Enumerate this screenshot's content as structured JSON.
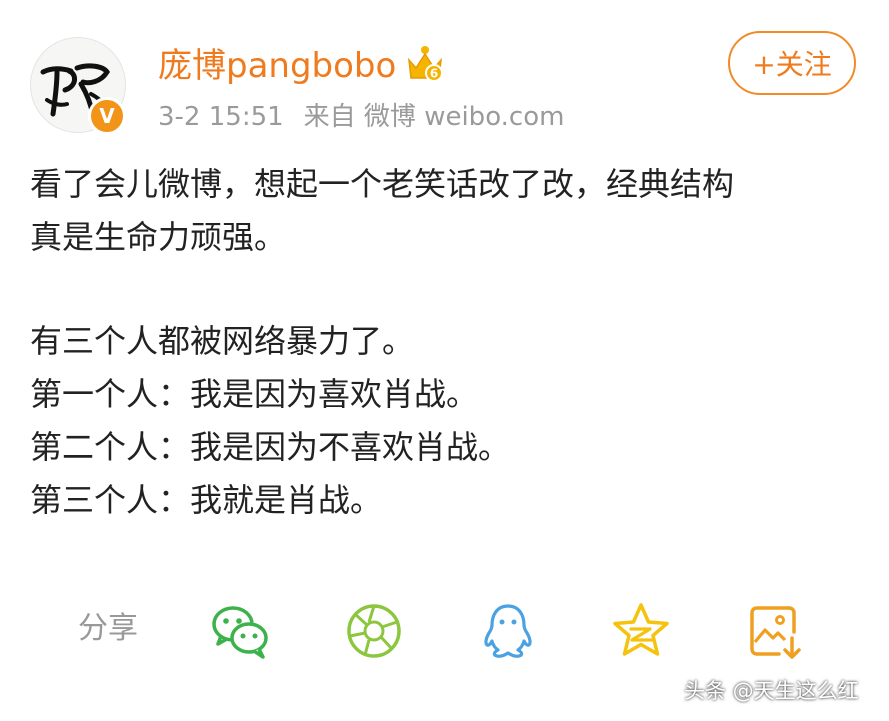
{
  "header": {
    "username": "庞博pangbobo",
    "verified_badge": "V",
    "level_badge": "6",
    "time": "3-2 15:51",
    "source": "来自 微博 weibo.com",
    "follow_label": "+关注"
  },
  "post": {
    "paragraphs": [
      "看了会儿微博，想起一个老笑话改了改，经典结构",
      "真是生命力顽强。",
      "",
      "有三个人都被网络暴力了。",
      "第一个人：我是因为喜欢肖战。",
      "第二个人：我是因为不喜欢肖战。",
      "第三个人：我就是肖战。"
    ]
  },
  "share": {
    "label": "分享",
    "icons": [
      "wechat-icon",
      "moments-icon",
      "qq-icon",
      "qzone-icon",
      "save-image-icon"
    ]
  },
  "watermark": "头条 @天生这么红",
  "colors": {
    "accent": "#f07b1e",
    "wechat": "#3cb34a",
    "moments": "#8cc63f",
    "qq": "#4aa3e0",
    "qzone": "#f5c20e",
    "save": "#f0a020",
    "meta_gray": "#9a9a9a"
  }
}
